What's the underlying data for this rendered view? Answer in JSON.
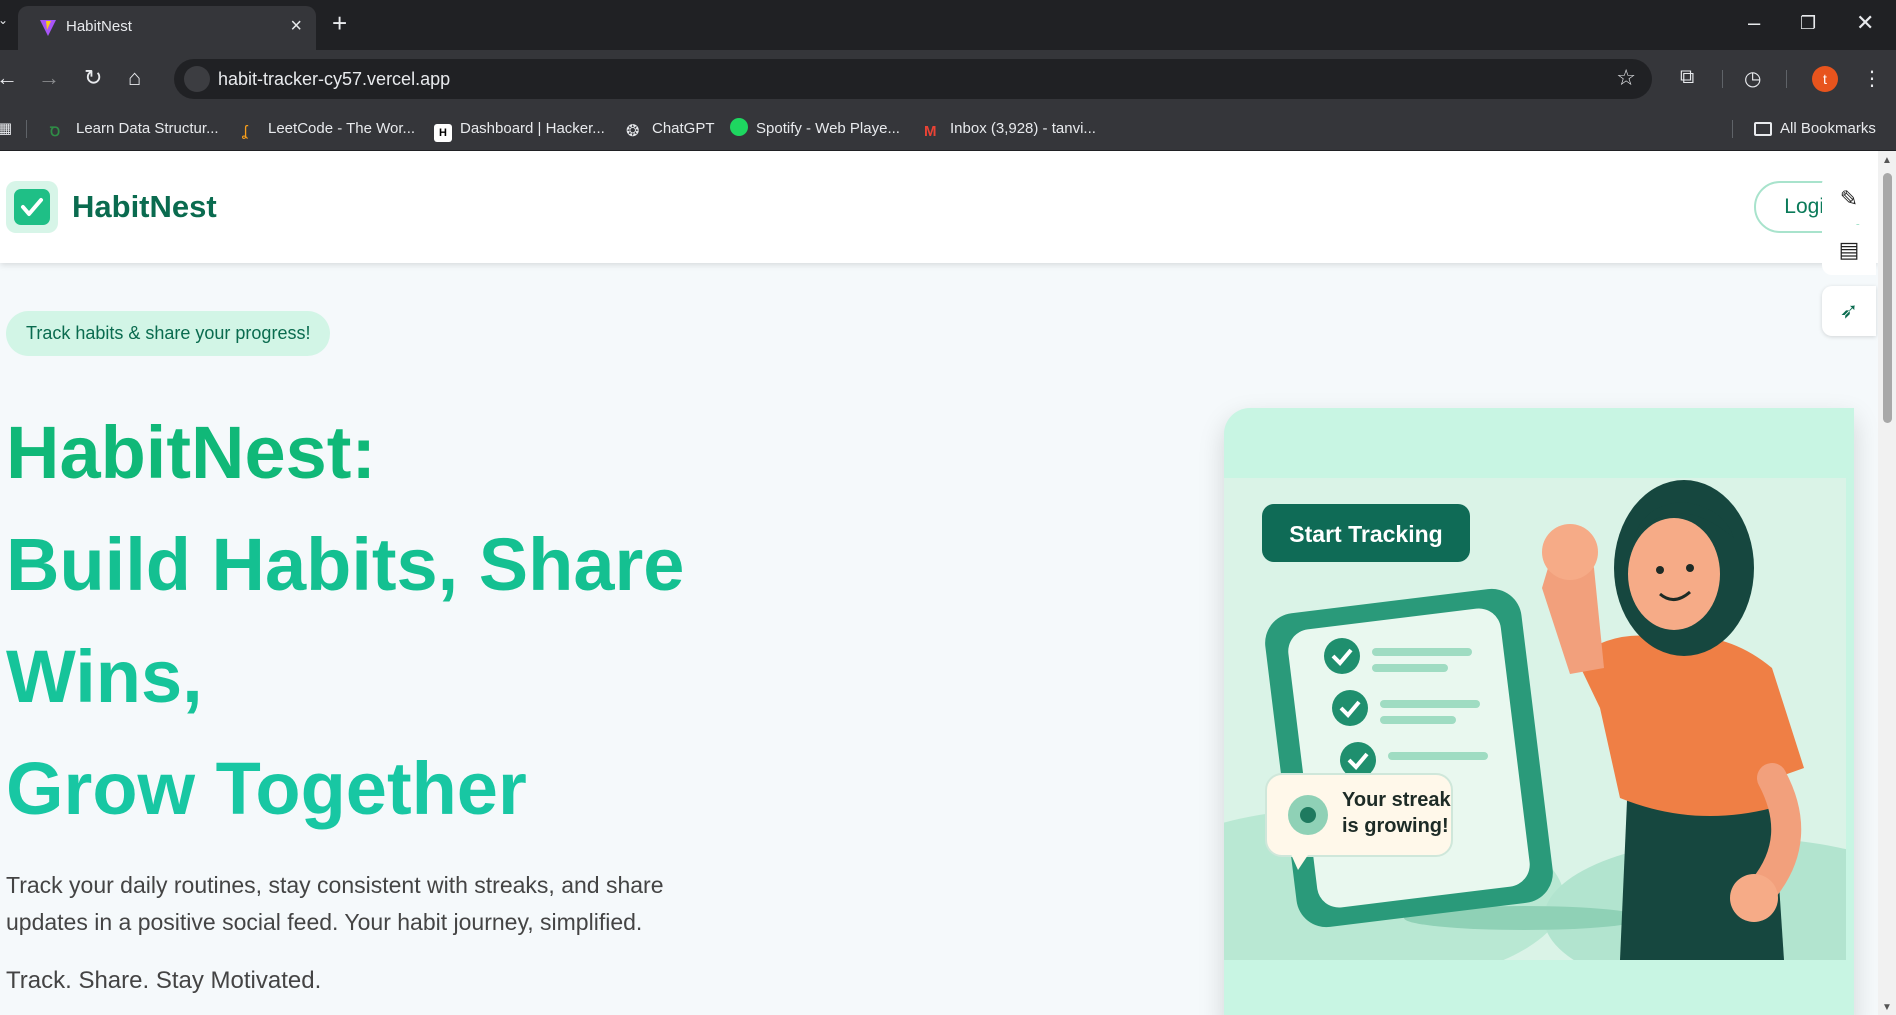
{
  "browser": {
    "tab_title": "HabitNest",
    "url": "habit-tracker-cy57.vercel.app",
    "profile_initial": "t",
    "bookmarks": [
      {
        "label": "Learn Data Structur...",
        "icon": "gfg-icon",
        "color": "#2f8d46"
      },
      {
        "label": "LeetCode - The Wor...",
        "icon": "leetcode-icon",
        "color": "#f89f1b"
      },
      {
        "label": "Dashboard | Hacker...",
        "icon": "hackerrank-icon",
        "color": "#ffffff"
      },
      {
        "label": "ChatGPT",
        "icon": "chatgpt-icon",
        "color": "#e8eaed"
      },
      {
        "label": "Spotify - Web Playe...",
        "icon": "spotify-icon",
        "color": "#1ed760"
      },
      {
        "label": "Inbox (3,928) - tanvi...",
        "icon": "gmail-icon",
        "color": "#ea4335"
      }
    ],
    "all_bookmarks_label": "All Bookmarks"
  },
  "header": {
    "brand": "HabitNest",
    "login_label": "Login"
  },
  "hero": {
    "pill": "Track habits & share your progress!",
    "headline_1": "HabitNest:",
    "headline_2": "Build Habits, Share",
    "headline_3": "Wins,",
    "headline_4": "Grow Together",
    "description": "Track your daily routines, stay consistent with streaks, and share updates in a positive social feed. Your habit journey, simplified.",
    "tagline": "Track. Share. Stay Motivated."
  },
  "illustration": {
    "cta_label": "Start Tracking",
    "bubble_line1": "Your streak",
    "bubble_line2": "is growing!"
  },
  "colors": {
    "brand_dark": "#0a6b4f",
    "brand_green": "#10b878",
    "accent_teal": "#18c7a3",
    "pill_bg": "#d2f5e6"
  }
}
